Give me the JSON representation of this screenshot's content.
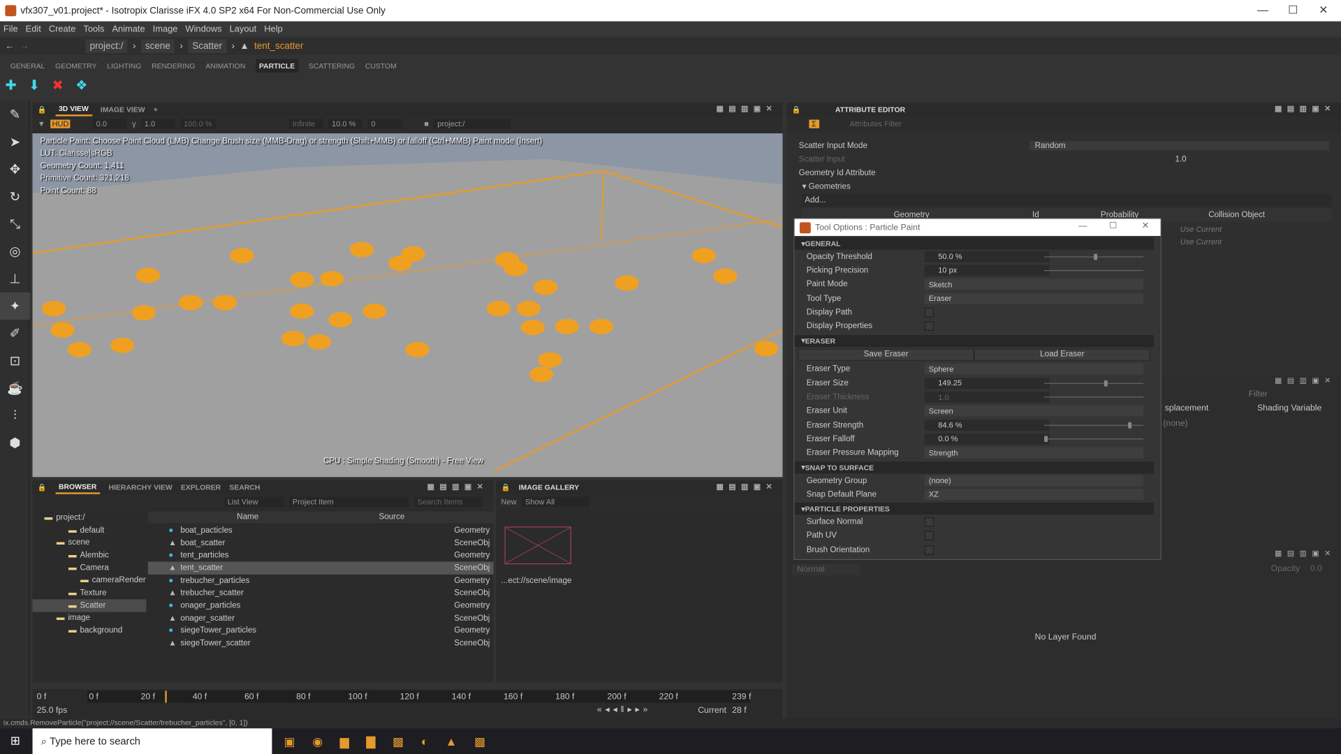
{
  "window": {
    "title": "vfx307_v01.project* - Isotropix Clarisse iFX 4.0 SP2 x64  For Non-Commercial Use Only"
  },
  "menu": [
    "File",
    "Edit",
    "Create",
    "Tools",
    "Animate",
    "Image",
    "Windows",
    "Layout",
    "Help"
  ],
  "breadcrumb": [
    "project:/",
    "scene",
    "Scatter",
    "tent_scatter"
  ],
  "shelf_tabs": [
    "GENERAL",
    "GEOMETRY",
    "LIGHTING",
    "RENDERING",
    "ANIMATION",
    "PARTICLE",
    "SCATTERING",
    "CUSTOM"
  ],
  "shelf_active": "PARTICLE",
  "viewport": {
    "tabs": [
      "3D VIEW",
      "IMAGE VIEW"
    ],
    "toolbar": {
      "exposure": "0.0",
      "gamma": "1.0",
      "opacity": "100.0 %",
      "distance": "Infinite",
      "percent": "10.0 %",
      "value": "0",
      "path": "project:/"
    },
    "hud": [
      "Particle Paint: Choose Point Cloud (LMB)  Change Brush size (MMB-Drag) or strength (Shift+MMB) or falloff (Ctrl+MMB)  Paint mode (Insert)",
      "LUT: Clarisse|sRGB",
      "Geometry Count: 1,411",
      "Primitive Count: 321,218",
      "Point Count: 88"
    ],
    "shading": "CPU : Simple Shading (Smooth) - Free View"
  },
  "browser": {
    "tabs": [
      "BROWSER",
      "HIERARCHY VIEW",
      "EXPLORER",
      "SEARCH"
    ],
    "view": "List View",
    "filter": "Project Item",
    "search_placeholder": "Search Items",
    "tree": [
      "project:/",
      "default",
      "scene",
      "Alembic",
      "Camera",
      "cameraRender",
      "Texture",
      "Scatter",
      "image",
      "background"
    ],
    "columns": [
      "Name",
      "Source"
    ],
    "items": [
      {
        "name": "boat_pacticles",
        "type": "Geometry"
      },
      {
        "name": "boat_scatter",
        "type": "SceneObj"
      },
      {
        "name": "tent_particles",
        "type": "Geometry"
      },
      {
        "name": "tent_scatter",
        "type": "SceneObj"
      },
      {
        "name": "trebucher_particles",
        "type": "Geometry"
      },
      {
        "name": "trebucher_scatter",
        "type": "SceneObj"
      },
      {
        "name": "onager_particles",
        "type": "Geometry"
      },
      {
        "name": "onager_scatter",
        "type": "SceneObj"
      },
      {
        "name": "siegeTower_particles",
        "type": "Geometry"
      },
      {
        "name": "siegeTower_scatter",
        "type": "SceneObj"
      }
    ]
  },
  "gallery": {
    "tab": "IMAGE GALLERY",
    "new": "New",
    "show": "Show All",
    "path": "...ect://scene/image"
  },
  "timeline": {
    "start": "0 f",
    "end": "239 f",
    "fps": "25.0 fps",
    "ticks": [
      "0 f",
      "20 f",
      "40 f",
      "60 f",
      "80 f",
      "100 f",
      "120 f",
      "140 f",
      "160 f",
      "180 f",
      "200 f",
      "220 f"
    ],
    "current_label": "Current",
    "current": "28 f"
  },
  "status": "ix.cmds.RemoveParticle(\"project://scene/Scatter/trebucher_particles\", [0, 1])",
  "taskbar": {
    "search": "Type here to search"
  },
  "attribute_editor": {
    "tab": "ATTRIBUTE EDITOR",
    "filter_placeholder": "Attributes Filter",
    "scatter_input_mode_label": "Scatter Input Mode",
    "scatter_input_mode": "Random",
    "scatter_input_label": "Scatter Input",
    "scatter_input": "1.0",
    "geometry_id_label": "Geometry Id Attribute",
    "geometries_label": "Geometries",
    "add": "Add...",
    "columns": [
      "Geometry",
      "Id",
      "Probability",
      "Collision Object"
    ],
    "collision": [
      "Use Current",
      "Use Current"
    ]
  },
  "tool_options": {
    "title": "Tool Options : Particle Paint",
    "general": {
      "title": "GENERAL",
      "opacity_threshold": "50.0 %",
      "picking_precision": "10 px",
      "paint_mode": "Sketch",
      "tool_type": "Eraser",
      "labels": [
        "Opacity Threshold",
        "Picking Precision",
        "Paint Mode",
        "Tool Type",
        "Display Path",
        "Display Properties"
      ]
    },
    "eraser": {
      "title": "ERASER",
      "save": "Save Eraser",
      "load": "Load Eraser",
      "labels": [
        "Eraser Type",
        "Eraser Size",
        "Eraser Thickness",
        "Eraser Unit",
        "Eraser Strength",
        "Eraser Falloff",
        "Eraser Pressure Mapping"
      ],
      "type": "Sphere",
      "size": "149.25",
      "thickness": "1.0",
      "unit": "Screen",
      "strength": "84.6 %",
      "falloff": "0.0 %",
      "pressure": "Strength"
    },
    "snap": {
      "title": "SNAP TO SURFACE",
      "labels": [
        "Geometry Group",
        "Snap Default Plane"
      ],
      "group": "(none)",
      "plane": "XZ"
    },
    "particle": {
      "title": "PARTICLE PROPERTIES",
      "labels": [
        "Surface Normal",
        "Path UV",
        "Brush Orientation"
      ]
    }
  },
  "right_panel": {
    "filter": "Filter",
    "columns": [
      "splacement",
      "Shading Variable"
    ],
    "value": "(none)"
  },
  "layers": {
    "blend": "Normal",
    "opacity_label": "Opacity",
    "opacity": "0.0",
    "empty": "No Layer Found"
  },
  "colors": {
    "accent": "#e59a2c",
    "scatter": "#f0a020"
  }
}
